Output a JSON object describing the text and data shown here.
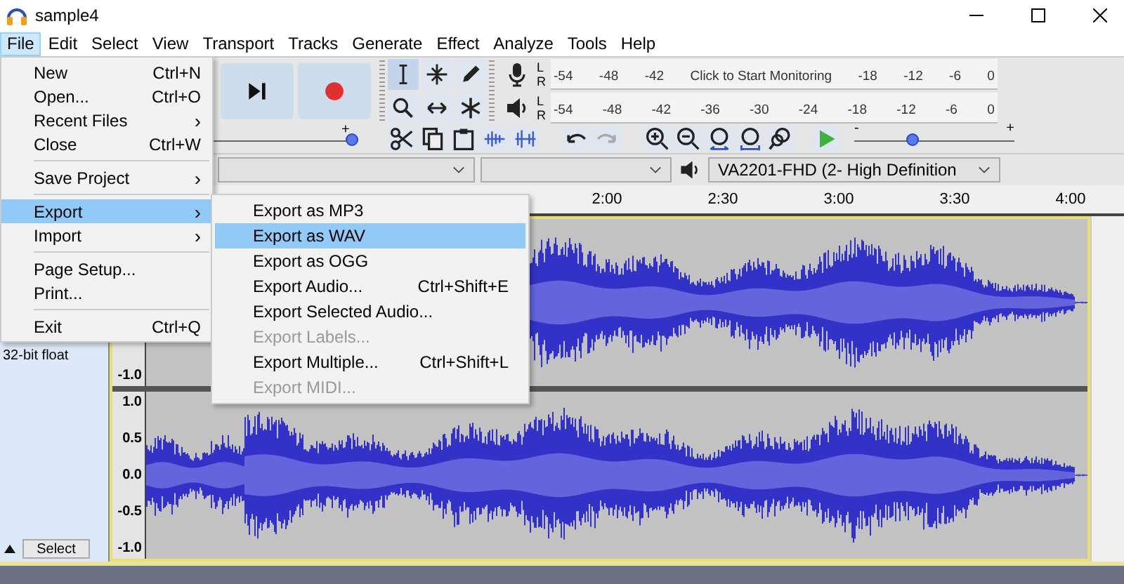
{
  "window": {
    "title": "sample4"
  },
  "menu_bar": [
    {
      "label": "File",
      "selected": true
    },
    {
      "label": "Edit",
      "selected": false
    },
    {
      "label": "Select",
      "selected": false
    },
    {
      "label": "View",
      "selected": false
    },
    {
      "label": "Transport",
      "selected": false
    },
    {
      "label": "Tracks",
      "selected": false
    },
    {
      "label": "Generate",
      "selected": false
    },
    {
      "label": "Effect",
      "selected": false
    },
    {
      "label": "Analyze",
      "selected": false
    },
    {
      "label": "Tools",
      "selected": false
    },
    {
      "label": "Help",
      "selected": false
    }
  ],
  "file_menu": [
    {
      "kind": "item",
      "label": "New",
      "shortcut": "Ctrl+N",
      "selected": false
    },
    {
      "kind": "item",
      "label": "Open...",
      "shortcut": "Ctrl+O",
      "selected": false
    },
    {
      "kind": "submenu",
      "label": "Recent Files",
      "arrow": "›",
      "selected": false
    },
    {
      "kind": "item",
      "label": "Close",
      "shortcut": "Ctrl+W",
      "selected": false
    },
    {
      "kind": "separator"
    },
    {
      "kind": "submenu",
      "label": "Save Project",
      "arrow": "›",
      "selected": false
    },
    {
      "kind": "separator"
    },
    {
      "kind": "submenu",
      "label": "Export",
      "arrow": "›",
      "selected": true
    },
    {
      "kind": "submenu",
      "label": "Import",
      "arrow": "›",
      "selected": false
    },
    {
      "kind": "separator"
    },
    {
      "kind": "item",
      "label": "Page Setup...",
      "selected": false
    },
    {
      "kind": "item",
      "label": "Print...",
      "selected": false
    },
    {
      "kind": "separator"
    },
    {
      "kind": "item",
      "label": "Exit",
      "shortcut": "Ctrl+Q",
      "selected": false
    }
  ],
  "export_submenu": [
    {
      "label": "Export as MP3",
      "selected": false,
      "disabled": false
    },
    {
      "label": "Export as WAV",
      "selected": true,
      "disabled": false
    },
    {
      "label": "Export as OGG",
      "selected": false,
      "disabled": false
    },
    {
      "label": "Export Audio...",
      "shortcut": "Ctrl+Shift+E",
      "selected": false,
      "disabled": false
    },
    {
      "label": "Export Selected Audio...",
      "selected": false,
      "disabled": false
    },
    {
      "label": "Export Labels...",
      "selected": false,
      "disabled": true
    },
    {
      "label": "Export Multiple...",
      "shortcut": "Ctrl+Shift+L",
      "selected": false,
      "disabled": false
    },
    {
      "label": "Export MIDI...",
      "selected": false,
      "disabled": true
    }
  ],
  "meters": [
    {
      "kind": "record",
      "channels": [
        "L",
        "R"
      ],
      "scale": [
        "-54",
        "-48",
        "-42",
        "Click to Start Monitoring",
        "-18",
        "-12",
        "-6",
        "0"
      ]
    },
    {
      "kind": "playback",
      "channels": [
        "L",
        "R"
      ],
      "scale": [
        "-54",
        "-48",
        "-42",
        "-36",
        "-30",
        "-24",
        "-18",
        "-12",
        "-6",
        "0"
      ]
    }
  ],
  "recording_volume": {
    "max_label": "+",
    "level": 1.0
  },
  "playback_speed": {
    "min_label": "-",
    "max_label": "+",
    "level": 0.36
  },
  "playback_device": "VA2201-FHD (2- High Definition",
  "timeline": [
    "2:00",
    "2:30",
    "3:00",
    "3:30",
    "4:00"
  ],
  "track": {
    "format": "32-bit float",
    "select_button": "Select",
    "channels": [
      {
        "ruler": [
          "-1.0"
        ]
      },
      {
        "ruler": [
          "1.0",
          "0.5",
          "0.0",
          "-0.5",
          "-1.0"
        ]
      }
    ]
  }
}
